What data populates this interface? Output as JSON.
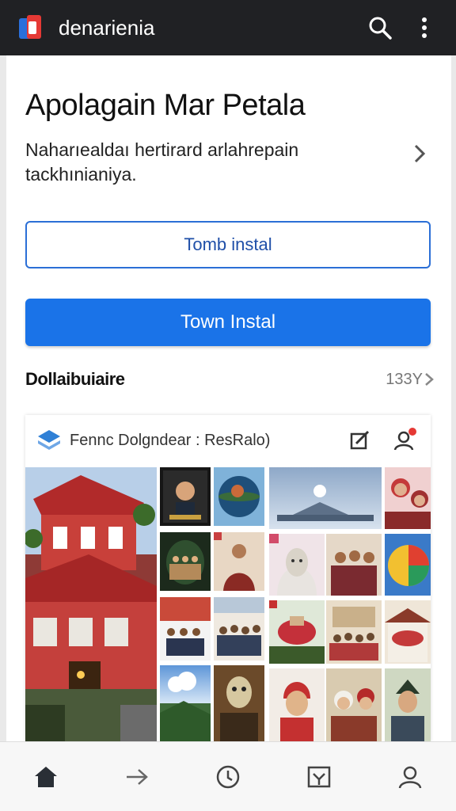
{
  "app": {
    "title": "denarienia"
  },
  "header": {
    "title": "Apolagain Mar Petala",
    "description": "Naharıealdaı hertirard arlahrepain tackhınianiya."
  },
  "buttons": {
    "outline_label": "Tomb instal",
    "primary_label": "Town Instal"
  },
  "section": {
    "title": "Dollaibuiaire",
    "count": "133Y"
  },
  "panel": {
    "title": "Fennc Dolgndear : ResRalo)"
  },
  "colors": {
    "primary": "#1a73e8",
    "topbar": "#202124",
    "notification": "#e53935"
  },
  "icons": {
    "top": [
      "search-icon",
      "more-vert-icon"
    ],
    "nav": [
      "home-icon",
      "forward-icon",
      "history-icon",
      "inbox-icon",
      "profile-icon"
    ]
  }
}
